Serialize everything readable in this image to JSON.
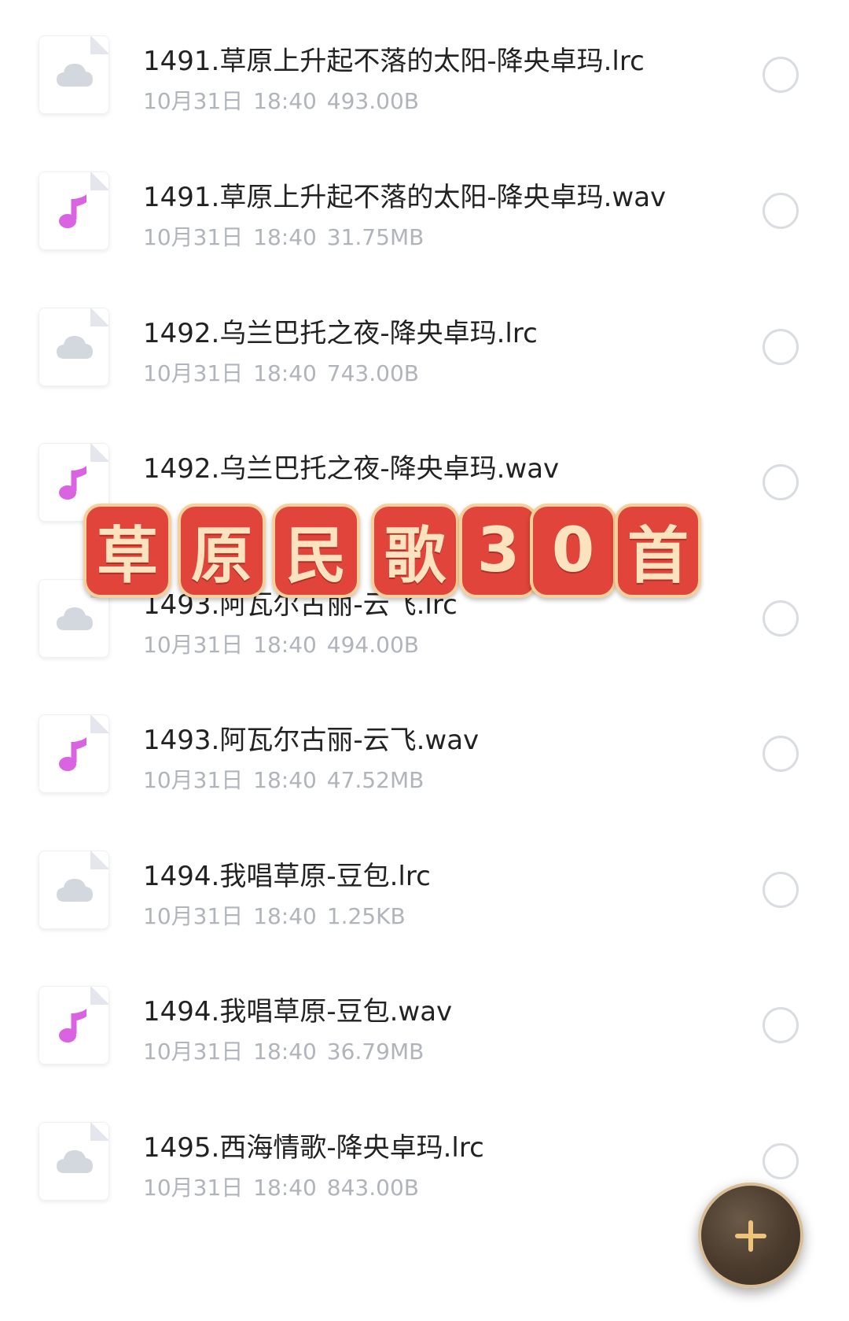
{
  "files": [
    {
      "name": "1491.草原上升起不落的太阳-降央卓玛.lrc",
      "date": "10月31日",
      "time": "18:40",
      "size": "493.00B",
      "icon": "cloud-file-icon"
    },
    {
      "name": "1491.草原上升起不落的太阳-降央卓玛.wav",
      "date": "10月31日",
      "time": "18:40",
      "size": "31.75MB",
      "icon": "music-note-icon"
    },
    {
      "name": "1492.乌兰巴托之夜-降央卓玛.lrc",
      "date": "10月31日",
      "time": "18:40",
      "size": "743.00B",
      "icon": "cloud-file-icon"
    },
    {
      "name": "1492.乌兰巴托之夜-降央卓玛.wav",
      "date": "",
      "time": "",
      "size": "",
      "icon": "music-note-icon"
    },
    {
      "name": "1493.阿瓦尔古丽-云飞.lrc",
      "date": "10月31日",
      "time": "18:40",
      "size": "494.00B",
      "icon": "cloud-file-icon"
    },
    {
      "name": "1493.阿瓦尔古丽-云飞.wav",
      "date": "10月31日",
      "time": "18:40",
      "size": "47.52MB",
      "icon": "music-note-icon"
    },
    {
      "name": "1494.我唱草原-豆包.lrc",
      "date": "10月31日",
      "time": "18:40",
      "size": "1.25KB",
      "icon": "cloud-file-icon"
    },
    {
      "name": "1494.我唱草原-豆包.wav",
      "date": "10月31日",
      "time": "18:40",
      "size": "36.79MB",
      "icon": "music-note-icon"
    },
    {
      "name": "1495.西海情歌-降央卓玛.lrc",
      "date": "10月31日",
      "time": "18:40",
      "size": "843.00B",
      "icon": "cloud-file-icon"
    }
  ],
  "banner": {
    "chars": [
      "草",
      "原",
      "民",
      "歌",
      "3",
      "0",
      "首"
    ]
  },
  "fab": {
    "icon": "plus-icon"
  },
  "colors": {
    "banner_tile": "#e0443a",
    "banner_text": "#fbe3bf",
    "music_icon": "#d963e0",
    "cloud_icon": "#d3d7de",
    "fab_bg": "#4a3b2d",
    "fab_plus": "#f0c37a"
  }
}
